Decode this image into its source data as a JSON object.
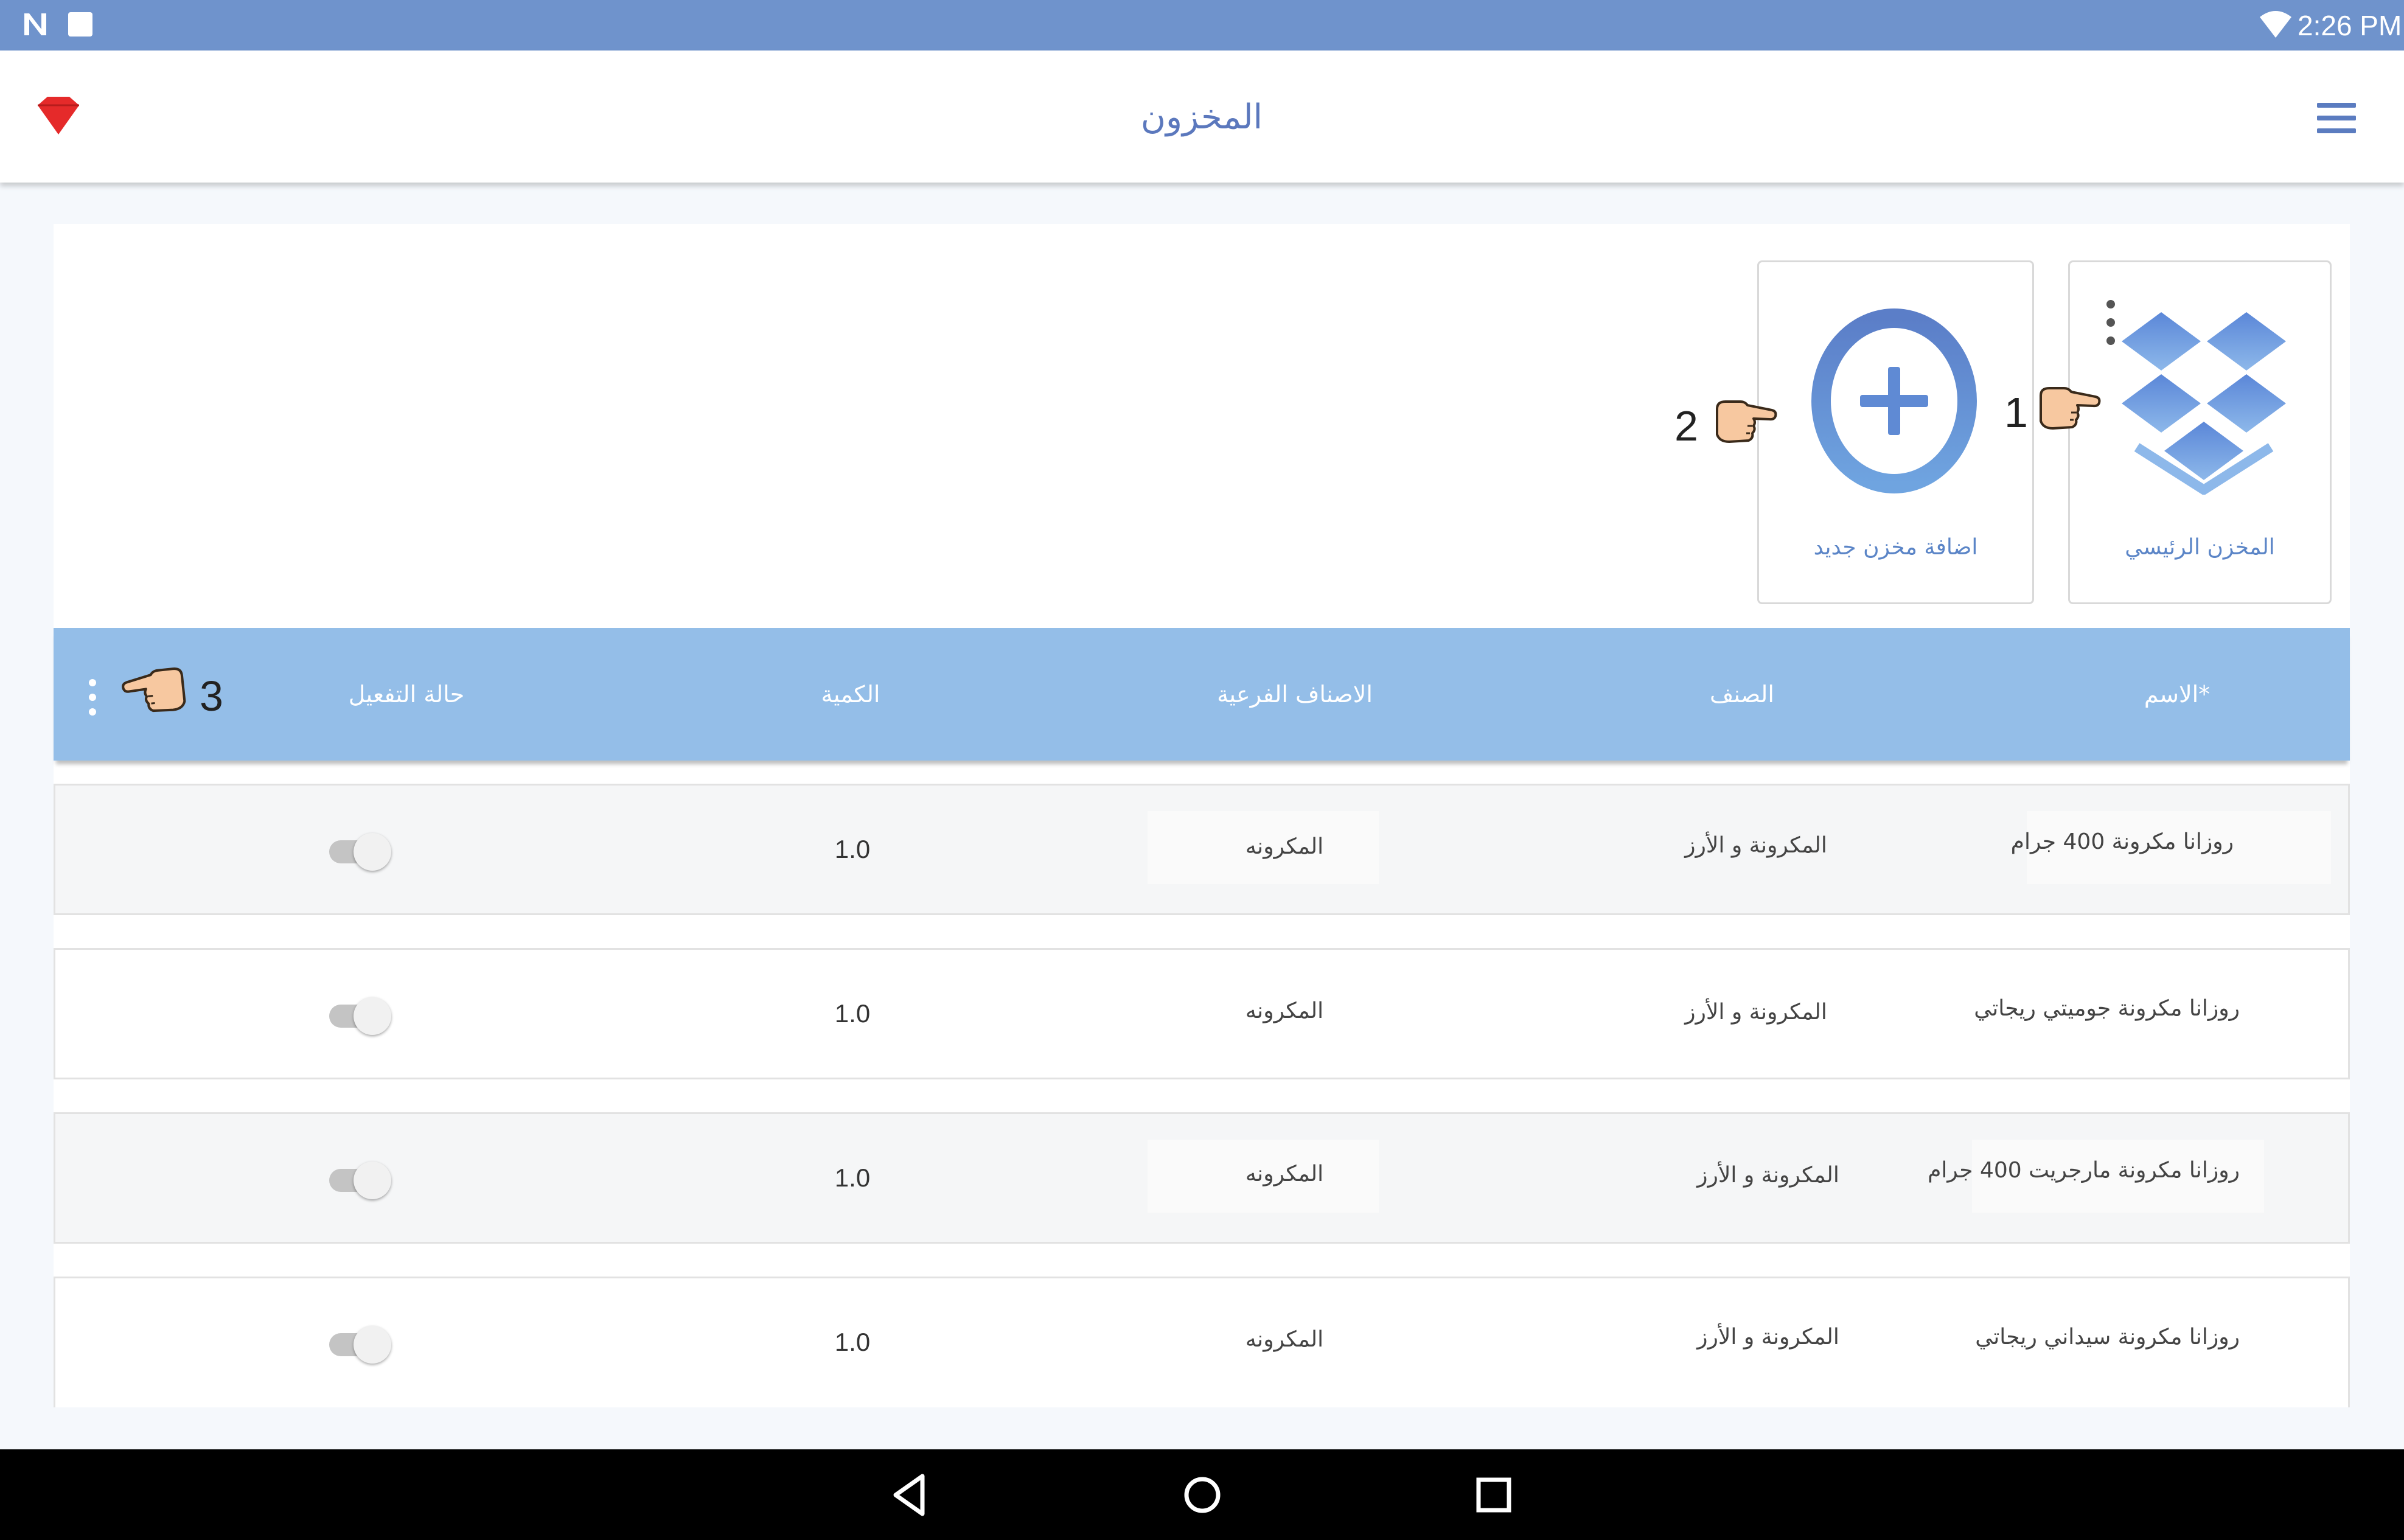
{
  "status_bar": {
    "time": "2:26 PM",
    "icons": [
      "n-icon",
      "square-icon",
      "wifi-icon"
    ]
  },
  "app_bar": {
    "title": "المخزون",
    "icons": [
      "logo-icon",
      "hamburger-menu-icon"
    ],
    "logo_color": "#e52a2a"
  },
  "warehouses": [
    {
      "label": "المخزن الرئيسي",
      "icon": "dropbox-icon"
    },
    {
      "label": "اضافة مخزن جديد",
      "icon": "add-circle-icon"
    }
  ],
  "annotations": [
    "1",
    "2",
    "3"
  ],
  "table": {
    "headers": {
      "name": "الاسم*",
      "category": "الصنف",
      "subcategories": "الاصناف الفرعية",
      "quantity": "الكمية",
      "status": "حالة التفعيل"
    },
    "rows": [
      {
        "name": "روزانا مكرونة 400 جرام",
        "category": "المكرونة و الأرز",
        "subcategory": "المكرونه",
        "quantity": "1.0",
        "active": false
      },
      {
        "name": "روزانا مكرونة جوميتي ريجاتي",
        "category": "المكرونة و الأرز",
        "subcategory": "المكرونه",
        "quantity": "1.0",
        "active": false
      },
      {
        "name": "روزانا مكرونة مارجريت 400 جرام",
        "category": "المكرونة و الأرز",
        "subcategory": "المكرونه",
        "quantity": "1.0",
        "active": false
      },
      {
        "name": "روزانا مكرونة سيداني ريجاتي",
        "category": "المكرونة و الأرز",
        "subcategory": "المكرونه",
        "quantity": "1.0",
        "active": false
      }
    ]
  },
  "nav_bar": {
    "icons": [
      "back-icon",
      "home-icon",
      "recents-icon"
    ]
  },
  "colors": {
    "status_bar": "#6f93cc",
    "accent": "#5b78bd",
    "table_header": "#94bee8",
    "nav_bar": "#000000"
  }
}
